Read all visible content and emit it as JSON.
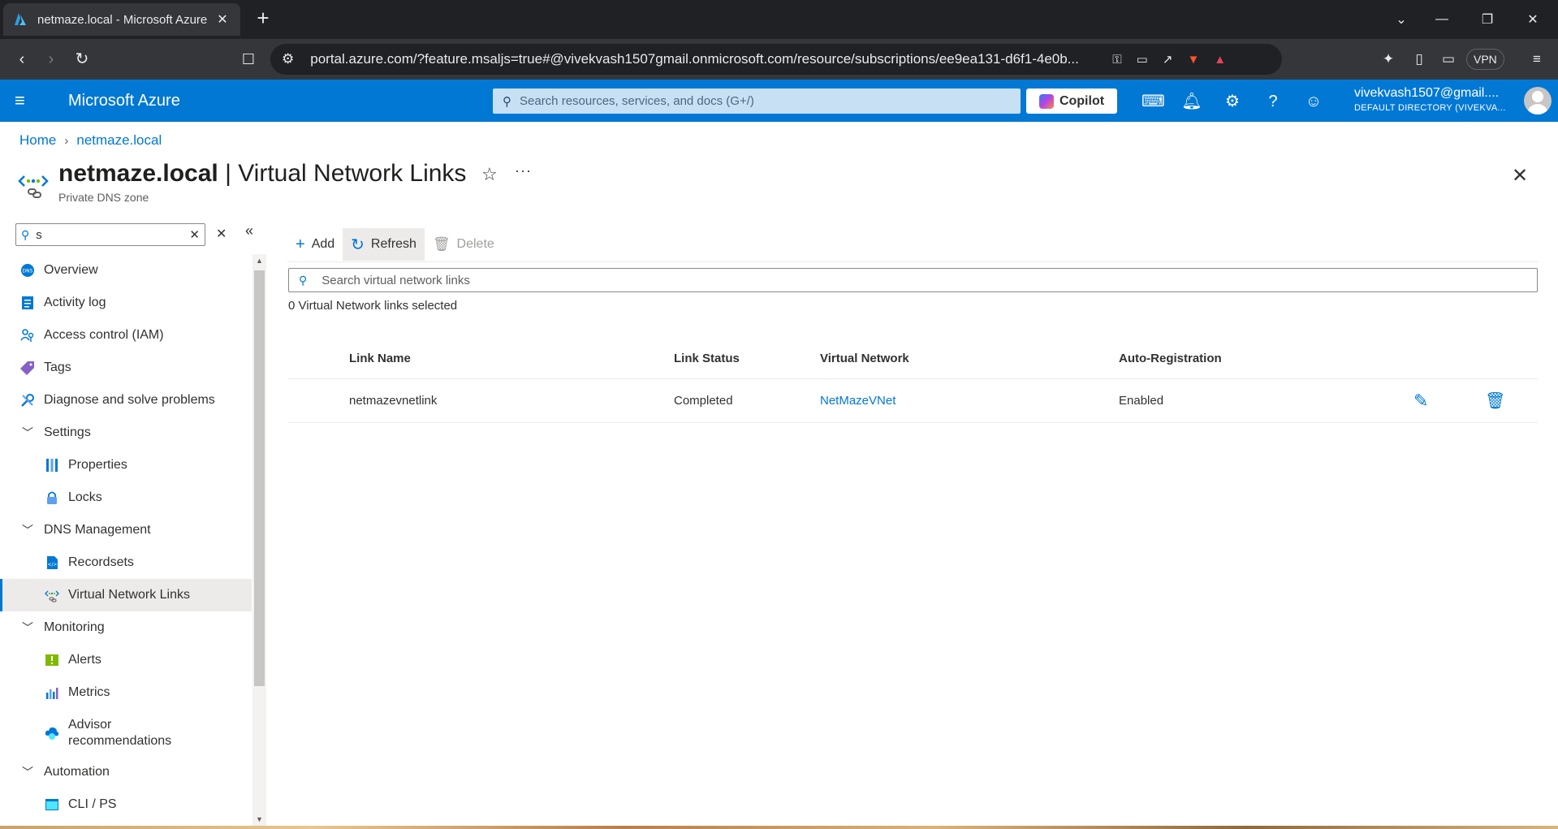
{
  "browser": {
    "tab_title": "netmaze.local - Microsoft Azure",
    "url": "portal.azure.com/?feature.msaljs=true#@vivekvash1507gmail.onmicrosoft.com/resource/subscriptions/ee9ea131-d6f1-4e0b...",
    "vpn_label": "VPN"
  },
  "azure": {
    "brand": "Microsoft Azure",
    "search_placeholder": "Search resources, services, and docs (G+/)",
    "copilot_label": "Copilot",
    "account_name": "vivekvash1507@gmail....",
    "account_directory": "DEFAULT DIRECTORY (VIVEKVA..."
  },
  "breadcrumb": {
    "home": "Home",
    "resource": "netmaze.local"
  },
  "page": {
    "title_resource": "netmaze.local",
    "title_section": " | Virtual Network Links",
    "subtitle": "Private DNS zone"
  },
  "nav": {
    "search_value": "s",
    "items": [
      {
        "label": "Overview",
        "icon": "dns-icon"
      },
      {
        "label": "Activity log",
        "icon": "activity-log-icon"
      },
      {
        "label": "Access control (IAM)",
        "icon": "iam-icon"
      },
      {
        "label": "Tags",
        "icon": "tag-icon"
      },
      {
        "label": "Diagnose and solve problems",
        "icon": "wrench-icon"
      },
      {
        "label": "Settings",
        "icon": "chevron-down-icon"
      },
      {
        "label": "Properties",
        "icon": "properties-icon"
      },
      {
        "label": "Locks",
        "icon": "lock-icon"
      },
      {
        "label": "DNS Management",
        "icon": "chevron-down-icon"
      },
      {
        "label": "Recordsets",
        "icon": "recordsets-icon"
      },
      {
        "label": "Virtual Network Links",
        "icon": "vnet-link-icon"
      },
      {
        "label": "Monitoring",
        "icon": "chevron-down-icon"
      },
      {
        "label": "Alerts",
        "icon": "alert-icon"
      },
      {
        "label": "Metrics",
        "icon": "metrics-icon"
      },
      {
        "label": "Advisor",
        "label2": "recommendations",
        "icon": "advisor-icon"
      },
      {
        "label": "Automation",
        "icon": "chevron-down-icon"
      },
      {
        "label": "CLI / PS",
        "icon": "cli-icon"
      }
    ]
  },
  "toolbar": {
    "add": "Add",
    "refresh": "Refresh",
    "delete": "Delete"
  },
  "content": {
    "search_placeholder": "Search virtual network links",
    "selected_count": "0 Virtual Network links selected",
    "columns": [
      "Link Name",
      "Link Status",
      "Virtual Network",
      "Auto-Registration"
    ],
    "rows": [
      {
        "link_name": "netmazevnetlink",
        "status": "Completed",
        "vnet": "NetMazeVNet",
        "auto_registration": "Enabled"
      }
    ]
  },
  "colors": {
    "azure_blue": "#0078d4",
    "chrome_dark": "#202124"
  }
}
